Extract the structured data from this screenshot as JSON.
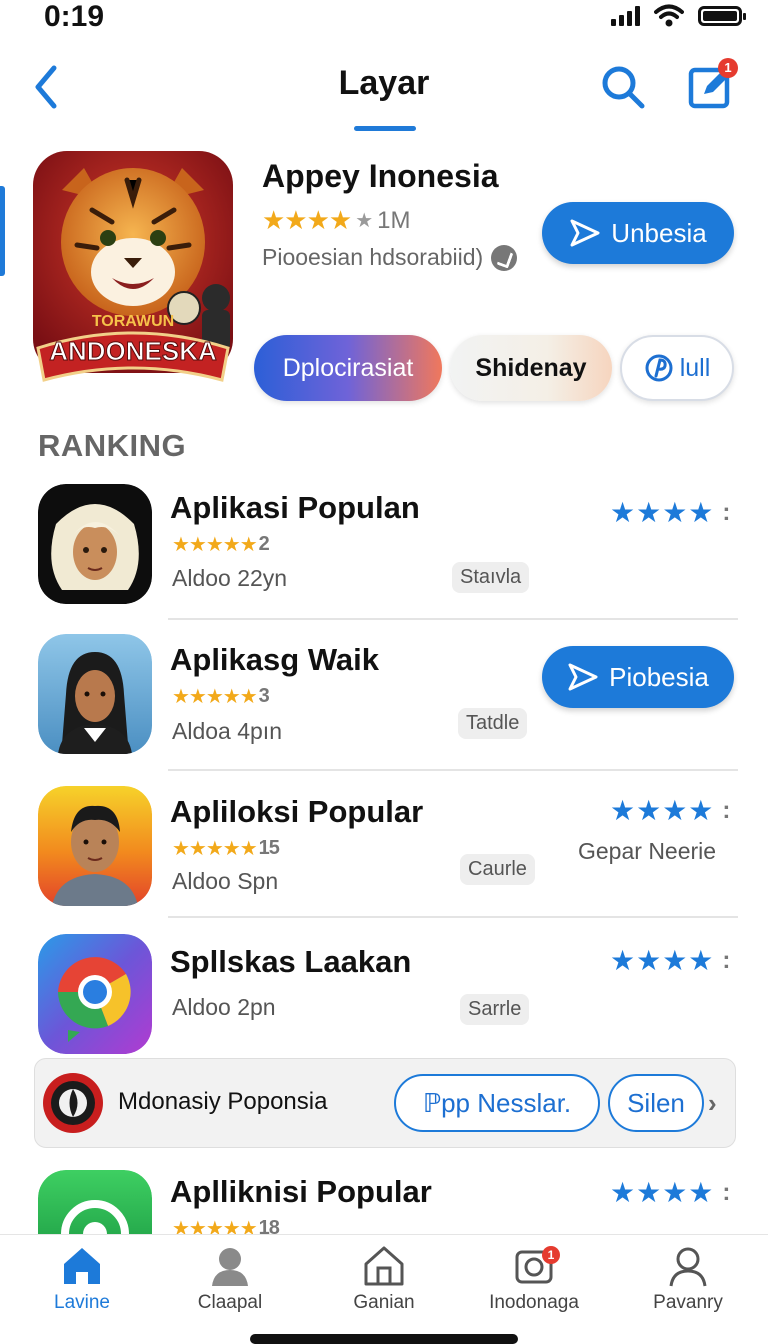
{
  "status_bar": {
    "time": "0:19"
  },
  "header": {
    "title": "Layar",
    "notification_count": "1"
  },
  "featured": {
    "badge_text_top": "TORAWUN",
    "badge_text_main": "ANDONESKA",
    "title": "Appey Inonesia",
    "stars": "★★★★",
    "grey_star": "★",
    "count": "1M",
    "subtitle": "Piooesian hdsorabiid)",
    "button_label": "Unbesia",
    "pills": [
      "Dplocirasiat",
      "Shidenay",
      "lull"
    ]
  },
  "ranking": {
    "label": "RANKING",
    "items": [
      {
        "title": "Aplikasi Populan",
        "stars": "★★★★★",
        "rating_num": "2",
        "sub": "Aldoo 22yn",
        "tag": "Staıvla",
        "right_stars": "★★★★",
        "more": ":"
      },
      {
        "title": "Aplikasg Waik",
        "stars": "★★★★★",
        "rating_num": "3",
        "sub": "Aldoa 4pın",
        "tag": "Tatdle",
        "button_label": "Piobesia"
      },
      {
        "title": "Apliloksi Popular",
        "stars": "★★★★★",
        "rating_num": "15",
        "sub": "Aldoo Spn",
        "tag": "Caurle",
        "right_stars": "★★★★",
        "more": ":",
        "right_text": "Gepar Neerie"
      },
      {
        "title": "Spllskas Laakan",
        "sub": "Aldoo 2pn",
        "tag": "Sarrle",
        "right_stars": "★★★★",
        "more": ":"
      }
    ],
    "last_item": {
      "title": "Aplliknisi Popular",
      "stars": "★★★★★",
      "rating_num": "18",
      "right_stars": "★★★★",
      "more": ":"
    }
  },
  "banner": {
    "text": "Mdonasiy Poponsia",
    "pill1": "ℙpp Nesslar.",
    "pill2": "Silen",
    "chevron": "›"
  },
  "bottom_nav": [
    {
      "label": "Lavine",
      "icon": "home-icon",
      "active": true
    },
    {
      "label": "Claapal",
      "icon": "person-icon"
    },
    {
      "label": "Ganian",
      "icon": "house-outline-icon"
    },
    {
      "label": "Inodonaga",
      "icon": "camera-icon",
      "badge": "1"
    },
    {
      "label": "Pavanry",
      "icon": "profile-icon"
    }
  ],
  "colors": {
    "accent": "#1d7ad9",
    "star": "#f2a91a",
    "badge": "#e53b2f"
  }
}
